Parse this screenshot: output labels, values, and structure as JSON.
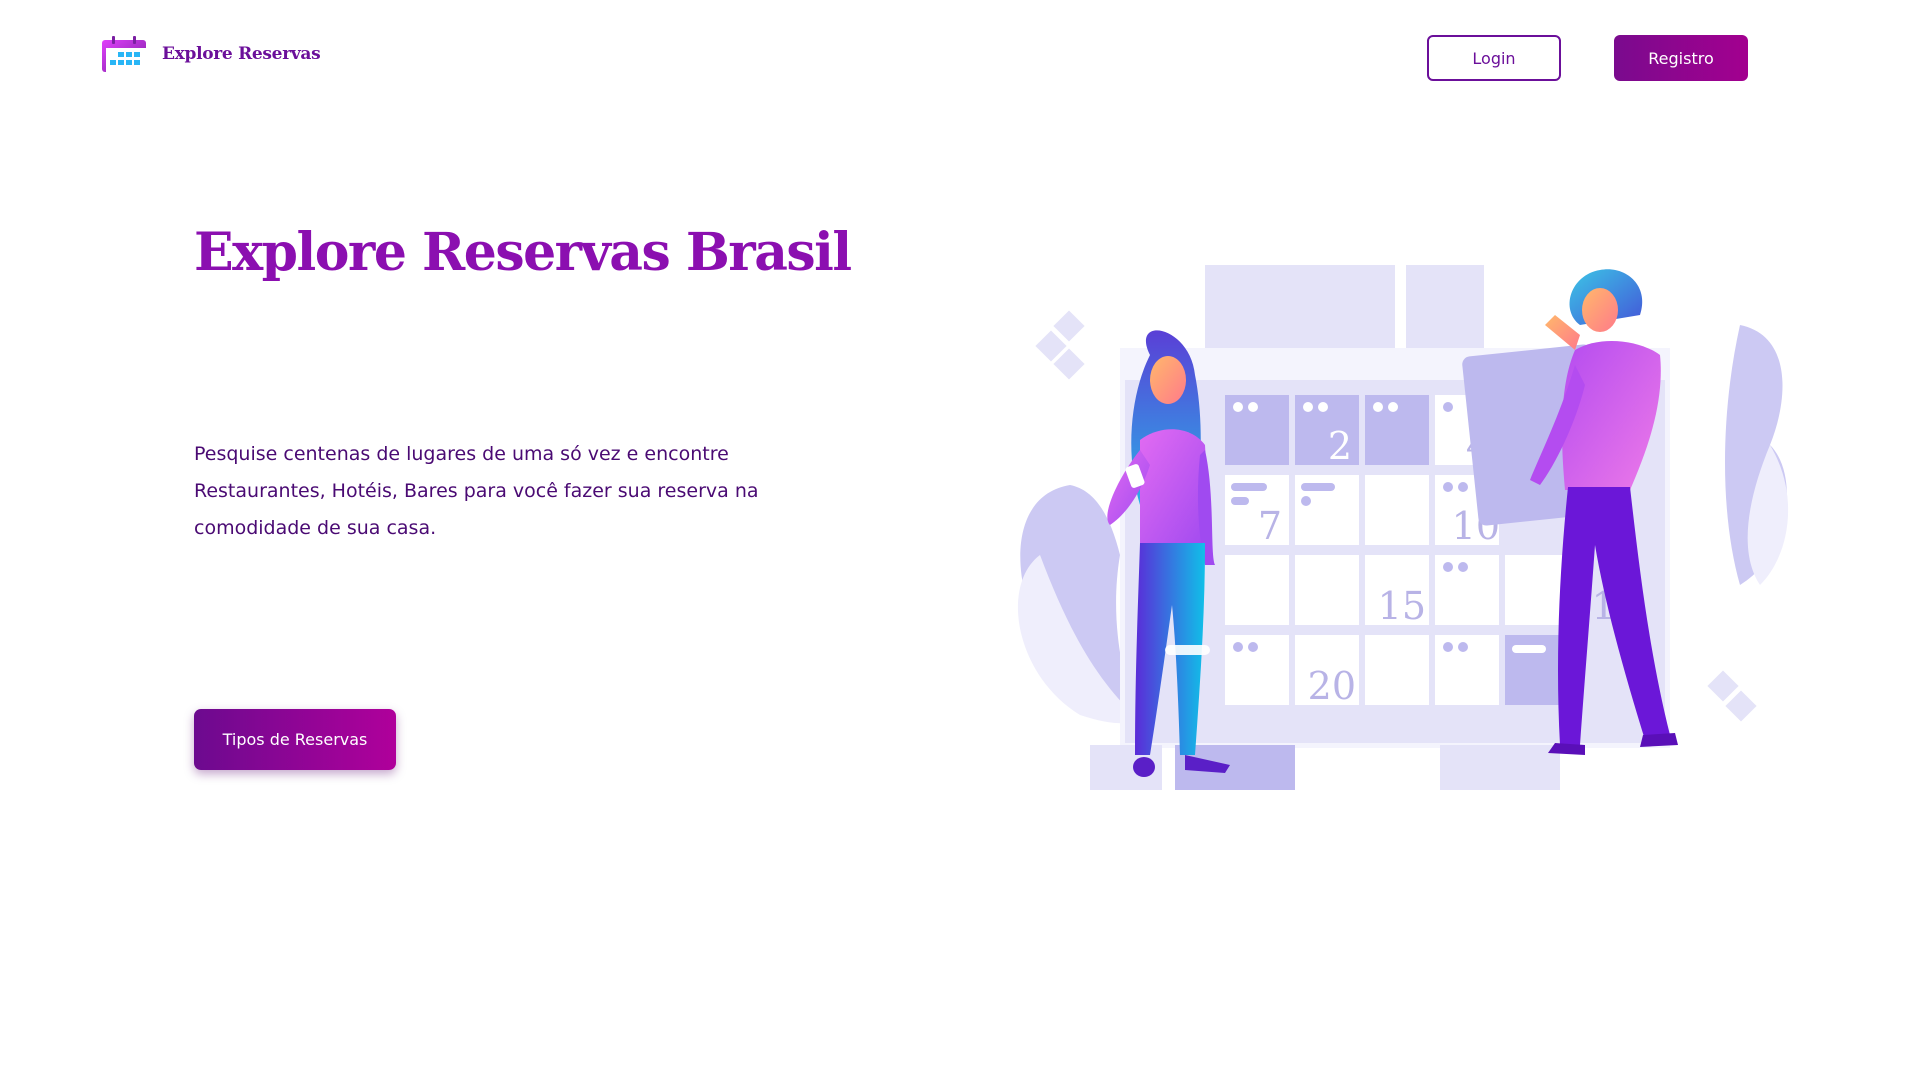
{
  "header": {
    "brand_name": "Explore Reservas",
    "login_label": "Login",
    "register_label": "Registro"
  },
  "hero": {
    "title": "Explore Reservas Brasil",
    "description": "Pesquise centenas de lugares de uma só vez e encontre Restaurantes, Hotéis, Bares para você fazer sua reserva na comodidade de sua casa.",
    "cta_label": "Tipos de Reservas"
  },
  "illustration": {
    "calendar_numbers": [
      "2",
      "4",
      "7",
      "10",
      "15",
      "18",
      "20"
    ]
  },
  "icons": {
    "logo": "calendar-icon"
  },
  "colors": {
    "brand_purple": "#6b0f9a",
    "title_purple": "#8b0fb0",
    "button_gradient_start": "#7a0a8e",
    "button_gradient_end": "#a3008f",
    "calendar_lavender": "#e4e3f8"
  }
}
